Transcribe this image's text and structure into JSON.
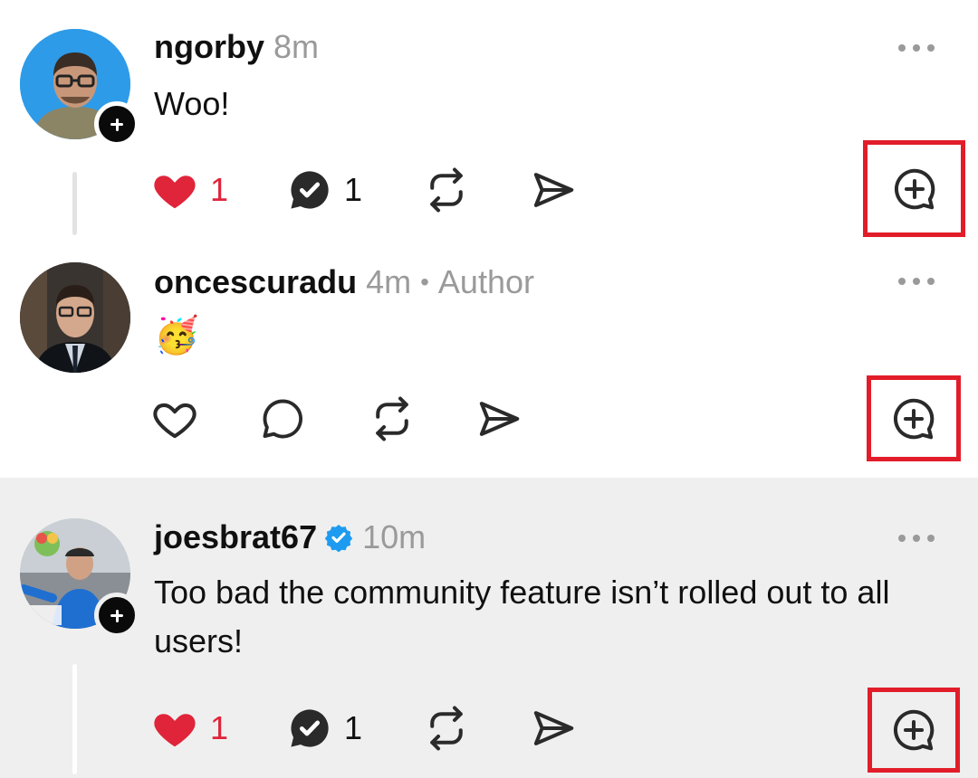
{
  "colors": {
    "like_red": "#e0243a",
    "highlight_red": "#e21d2a",
    "verified_blue": "#1d9bf0",
    "muted_gray": "#9a9a9a",
    "selected_row_bg": "#efefef"
  },
  "posts": [
    {
      "username": "ngorby",
      "time": "8m",
      "text": "Woo!",
      "likes": "1",
      "replies": "1",
      "liked": true,
      "has_follow_badge": true,
      "icons": [
        "heart-icon",
        "reply-icon",
        "repost-icon",
        "share-icon",
        "quote-add-icon"
      ]
    },
    {
      "username": "oncescuradu",
      "time": "4m",
      "separator": "•",
      "badge_label": "Author",
      "emoji": "🥳",
      "liked": false,
      "icons": [
        "heart-icon",
        "comment-icon",
        "repost-icon",
        "share-icon",
        "quote-add-icon"
      ]
    },
    {
      "username": "joesbrat67",
      "verified": true,
      "time": "10m",
      "text": "Too bad the community feature isn’t rolled out to all users!",
      "likes": "1",
      "replies": "1",
      "liked": true,
      "has_follow_badge": true,
      "icons": [
        "heart-icon",
        "reply-icon",
        "repost-icon",
        "share-icon",
        "quote-add-icon"
      ]
    }
  ]
}
